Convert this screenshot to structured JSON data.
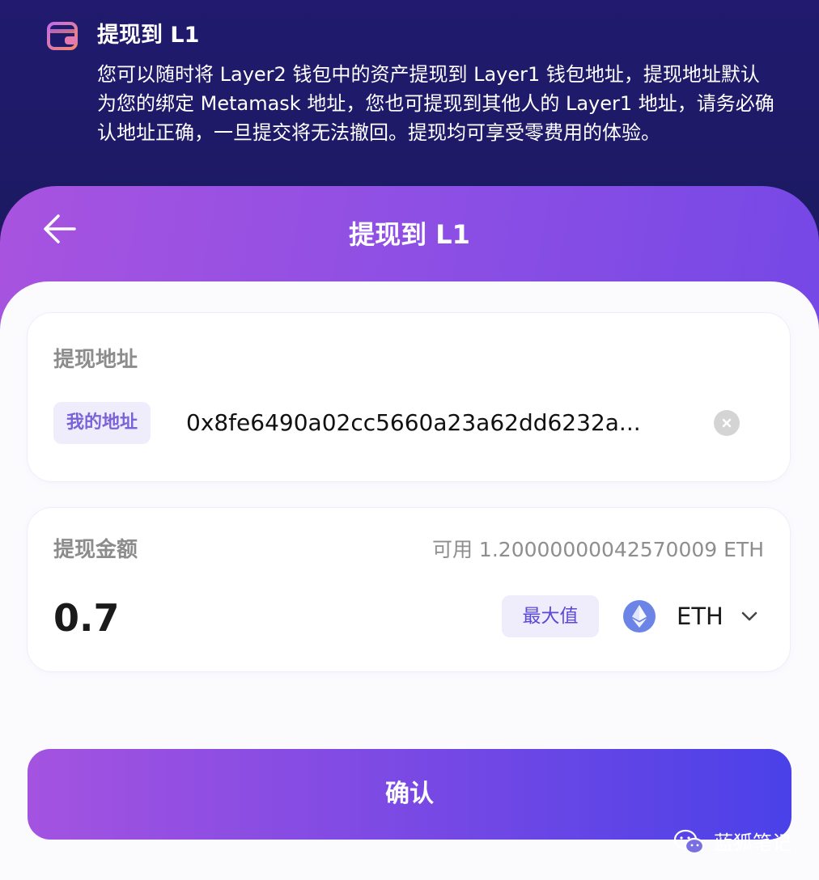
{
  "banner": {
    "icon": "wallet-icon",
    "title": "提现到 L1",
    "description": "您可以随时将 Layer2 钱包中的资产提现到 Layer1 钱包地址，提现地址默认为您的绑定 Metamask 地址，您也可提现到其他人的 Layer1 地址，请务必确认地址正确，一旦提交将无法撤回。提现均可享受零费用的体验。"
  },
  "header": {
    "back_icon": "arrow-left-icon",
    "title": "提现到 L1"
  },
  "address_card": {
    "label": "提现地址",
    "chip_label": "我的地址",
    "address_value": "0x8fe6490a02cc5660a23a62dd6232a...",
    "clear_icon": "clear-icon"
  },
  "amount_card": {
    "label": "提现金额",
    "available": "可用 1.20000000042570009 ETH",
    "amount_value": "0.7",
    "max_label": "最大值",
    "token_icon": "eth-icon",
    "token_name": "ETH",
    "dropdown_icon": "chevron-down-icon"
  },
  "confirm_button": {
    "label": "确认"
  },
  "watermark": {
    "icon": "wechat-icon",
    "text": "蓝狐笔记"
  },
  "colors": {
    "banner_bg": "#1c1a62",
    "accent_purple": "#a853df",
    "accent_blue": "#4a41e8",
    "chip_bg": "#efedfb",
    "chip_text": "#7a63d8"
  }
}
